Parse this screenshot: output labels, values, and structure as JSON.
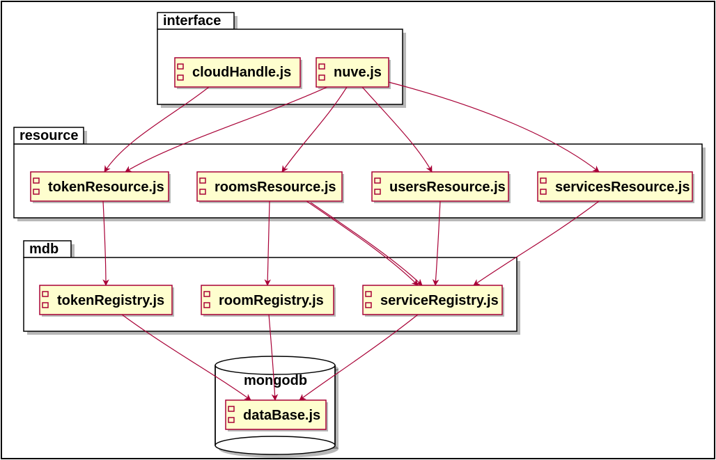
{
  "packages": {
    "interface": {
      "label": "interface"
    },
    "resource": {
      "label": "resource"
    },
    "mdb": {
      "label": "mdb"
    },
    "mongodb": {
      "label": "mongodb"
    }
  },
  "components": {
    "cloudHandle": {
      "label": "cloudHandle.js"
    },
    "nuve": {
      "label": "nuve.js"
    },
    "tokenResource": {
      "label": "tokenResource.js"
    },
    "roomsResource": {
      "label": "roomsResource.js"
    },
    "usersResource": {
      "label": "usersResource.js"
    },
    "servicesResource": {
      "label": "servicesResource.js"
    },
    "tokenRegistry": {
      "label": "tokenRegistry.js"
    },
    "roomRegistry": {
      "label": "roomRegistry.js"
    },
    "serviceRegistry": {
      "label": "serviceRegistry.js"
    },
    "dataBase": {
      "label": "dataBase.js"
    }
  },
  "chart_data": {
    "type": "uml-component-diagram",
    "packages": [
      {
        "name": "interface",
        "components": [
          "cloudHandle.js",
          "nuve.js"
        ]
      },
      {
        "name": "resource",
        "components": [
          "tokenResource.js",
          "roomsResource.js",
          "usersResource.js",
          "servicesResource.js"
        ]
      },
      {
        "name": "mdb",
        "components": [
          "tokenRegistry.js",
          "roomRegistry.js",
          "serviceRegistry.js"
        ]
      },
      {
        "name": "mongodb",
        "components": [
          "dataBase.js"
        ],
        "shape": "database"
      }
    ],
    "edges": [
      {
        "from": "cloudHandle.js",
        "to": "tokenResource.js"
      },
      {
        "from": "nuve.js",
        "to": "tokenResource.js"
      },
      {
        "from": "nuve.js",
        "to": "roomsResource.js"
      },
      {
        "from": "nuve.js",
        "to": "usersResource.js"
      },
      {
        "from": "nuve.js",
        "to": "servicesResource.js"
      },
      {
        "from": "tokenResource.js",
        "to": "tokenRegistry.js"
      },
      {
        "from": "roomsResource.js",
        "to": "roomRegistry.js"
      },
      {
        "from": "roomsResource.js",
        "to": "serviceRegistry.js"
      },
      {
        "from": "usersResource.js",
        "to": "serviceRegistry.js"
      },
      {
        "from": "servicesResource.js",
        "to": "serviceRegistry.js"
      },
      {
        "from": "tokenRegistry.js",
        "to": "dataBase.js"
      },
      {
        "from": "roomRegistry.js",
        "to": "dataBase.js"
      },
      {
        "from": "serviceRegistry.js",
        "to": "dataBase.js"
      }
    ]
  }
}
